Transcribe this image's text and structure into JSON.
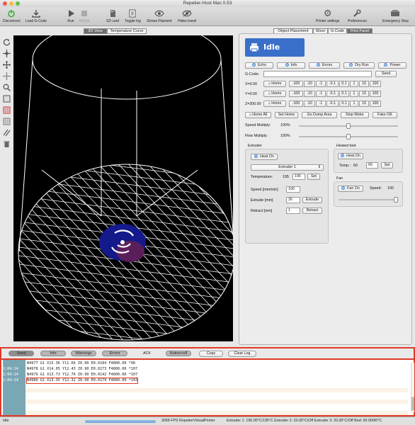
{
  "window": {
    "title": "Repetier-Host Mac 0.53"
  },
  "toolbar": {
    "disconnect": "Disconnect",
    "load_gcode": "Load G-Code",
    "run": "Run",
    "kill_job": "Kill job",
    "sd_card": "SD card",
    "toggle_log": "Toggle log",
    "shows_filament": "Shows Filament",
    "hides_travel": "Hides travel",
    "printer_settings": "Printer settings",
    "preferences": "Preferences",
    "emergency_stop": "Emergency Stop"
  },
  "view_tabs": [
    "3D View",
    "Temperature Curve"
  ],
  "panel_tabs": [
    "Object Placement",
    "Slicer",
    "G-Code",
    "Print Panel"
  ],
  "print_panel": {
    "status": "Idle",
    "toggles": {
      "echo": "Echo",
      "info": "Info",
      "errors": "Errors",
      "dry_run": "Dry Run",
      "power": "Power"
    },
    "gcode_label": "G-Code:",
    "gcode_value": "",
    "send": "Send",
    "axes": [
      {
        "label": "X=0.00",
        "home": "Home",
        "steps": [
          "-100",
          "-10",
          "-1",
          "-0.1",
          "0.1",
          "1",
          "10",
          "100"
        ]
      },
      {
        "label": "Y=0.00",
        "home": "Home",
        "steps": [
          "-100",
          "-10",
          "-1",
          "-0.1",
          "0.1",
          "1",
          "10",
          "100"
        ]
      },
      {
        "label": "Z=200.00",
        "home": "Home",
        "steps": [
          "-100",
          "-10",
          "-1",
          "-0.1",
          "0.1",
          "1",
          "10",
          "100"
        ]
      }
    ],
    "actions": {
      "home_all": "Home All",
      "set_home": "Set Home",
      "go_dump": "Go Dump Area",
      "stop_motor": "Stop Motor",
      "fake_ok": "Fake OK"
    },
    "speed_multiply": {
      "label": "Speed Multiply:",
      "value": "100%",
      "level": 0.5
    },
    "flow_multiply": {
      "label": "Flow Multiply:",
      "value": "100%",
      "level": 0.5
    },
    "extruder": {
      "title": "Extruder",
      "heat_on": "Heat On",
      "select": "Extruder 1",
      "temp_label": "Temperature:",
      "temp_current": "195",
      "temp_value": "195",
      "set": "Set",
      "speed_label": "Speed [mm/min]",
      "speed_value": "100",
      "extrude_label": "Extrude [mm]",
      "extrude_value": "30",
      "extrude_btn": "Extrude",
      "retract_label": "Retract [mm]",
      "retract_value": "1",
      "retract_btn": "Retract"
    },
    "heated_bed": {
      "title": "Heated bed",
      "heat_on": "Heat On",
      "temp_label": "Temp.:",
      "temp_current": "60",
      "temp_value": "60",
      "set": "Set"
    },
    "fan": {
      "title": "Fan",
      "fan_on": "Fan On",
      "speed_label": "Speed:",
      "speed_value": "100"
    }
  },
  "log": {
    "filters": [
      "Send",
      "Info",
      "Warnings",
      "Errors",
      "ACK",
      "Autoscroll",
      "Copy",
      "Clear Log"
    ],
    "rows": [
      {
        "time": "",
        "text": "N4977 G1 X15.36 Y11.66 Z0.90 E0.0184 F4800.00 *98"
      },
      {
        "time": "1:04:14",
        "text": "N4978 G1 X14.05 Y12.43 Z0.90 E0.0273 F4800.00 *107"
      },
      {
        "time": "1:04:14",
        "text": "N4979 G1 X13.73 Y12.76 Z0.90 E0.0142 F4800.00 *107"
      },
      {
        "time": "1:04:14",
        "text": "N4980 G1 X13.35 Y12.32 Z0.90 E0.0179 F4800.00 *103"
      }
    ]
  },
  "status_bar": {
    "status": "Idle",
    "fps": "3058 FPS RepetierVirtualPrinter",
    "temps": "Extruder 1: 195.00°C/195°C Extruder 2: 20.00°C/Off Extruder 3: 20.00°C/Off Bed: 60.00/60°C"
  },
  "colors": {
    "accent": "#3a6fc9",
    "highlight": "#e03a2a",
    "log_gutter": "#7aa7b4"
  }
}
